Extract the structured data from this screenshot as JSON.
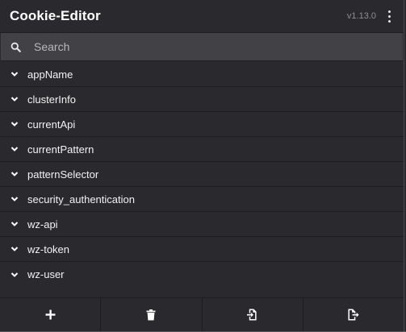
{
  "app": {
    "title": "Cookie-Editor",
    "version": "v1.13.0",
    "menu_icon": "more-vertical-icon"
  },
  "search": {
    "placeholder": "Search",
    "value": "",
    "icon": "search-icon"
  },
  "cookies": [
    {
      "name": "appName"
    },
    {
      "name": "clusterInfo"
    },
    {
      "name": "currentApi"
    },
    {
      "name": "currentPattern"
    },
    {
      "name": "patternSelector"
    },
    {
      "name": "security_authentication"
    },
    {
      "name": "wz-api"
    },
    {
      "name": "wz-token"
    },
    {
      "name": "wz-user"
    }
  ],
  "footer": {
    "buttons": [
      {
        "icon": "plus-icon"
      },
      {
        "icon": "trash-icon"
      },
      {
        "icon": "import-icon"
      },
      {
        "icon": "export-icon"
      }
    ]
  },
  "colors": {
    "background": "#2a2a2e",
    "search_background": "#414146",
    "text": "#ffffff",
    "muted_text": "#8d8d92"
  }
}
